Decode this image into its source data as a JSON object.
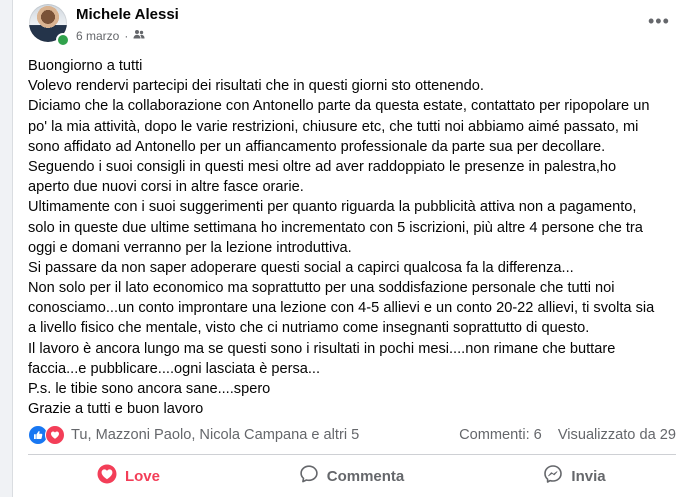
{
  "post": {
    "author": "Michele Alessi",
    "date": "6 marzo",
    "date_separator": "·",
    "lines": [
      "Buongiorno a tutti",
      "Volevo rendervi partecipi dei risultati che in questi giorni sto ottenendo.",
      "Diciamo che la collaborazione con Antonello parte da questa estate, contattato per ripopolare un",
      "po' la mia attività, dopo le varie restrizioni, chiusure etc, che tutti noi abbiamo aimé passato, mi",
      "sono affidato ad Antonello per un affiancamento professionale da parte sua per decollare.",
      "Seguendo i suoi consigli in questi mesi oltre ad aver raddoppiato le presenze in palestra,ho",
      "aperto due nuovi corsi in altre fasce orarie.",
      "Ultimamente con i suoi suggerimenti per quanto riguarda la pubblicità attiva non a pagamento,",
      "solo in queste due ultime settimana ho incrementato con 5 iscrizioni, più altre 4 persone che tra",
      "oggi e domani verranno per la lezione introduttiva.",
      "Si passare da non saper adoperare questi social a capirci qualcosa fa la differenza...",
      "Non solo per il lato economico ma soprattutto per una soddisfazione personale che tutti noi",
      "conosciamo...un conto improntare una lezione con 4-5 allievi e un conto 20-22 allievi, ti svolta sia",
      "a livello fisico che mentale, visto che ci nutriamo come insegnanti soprattutto di questo.",
      "Il lavoro è ancora lungo ma se questi sono i risultati in pochi mesi....non rimane che buttare",
      "faccia...e pubblicare....ogni lasciata è persa...",
      "P.s. le tibie sono ancora sane....spero",
      "Grazie a tutti e buon lavoro"
    ]
  },
  "reactions": {
    "summary": "Tu, Mazzoni Paolo, Nicola Campana e altri 5",
    "comments": "Commenti: 6",
    "views": "Visualizzato da 29"
  },
  "actions": {
    "love": "Love",
    "comment": "Commenta",
    "share": "Invia"
  },
  "colors": {
    "love": "#f33e58",
    "like": "#1877f2",
    "online": "#31a24c",
    "secondary_text": "#65676b"
  },
  "icons": [
    "more-options-icon",
    "audience-group-icon",
    "like-reaction-icon",
    "love-reaction-icon",
    "love-heart-icon",
    "comment-icon",
    "messenger-share-icon"
  ]
}
